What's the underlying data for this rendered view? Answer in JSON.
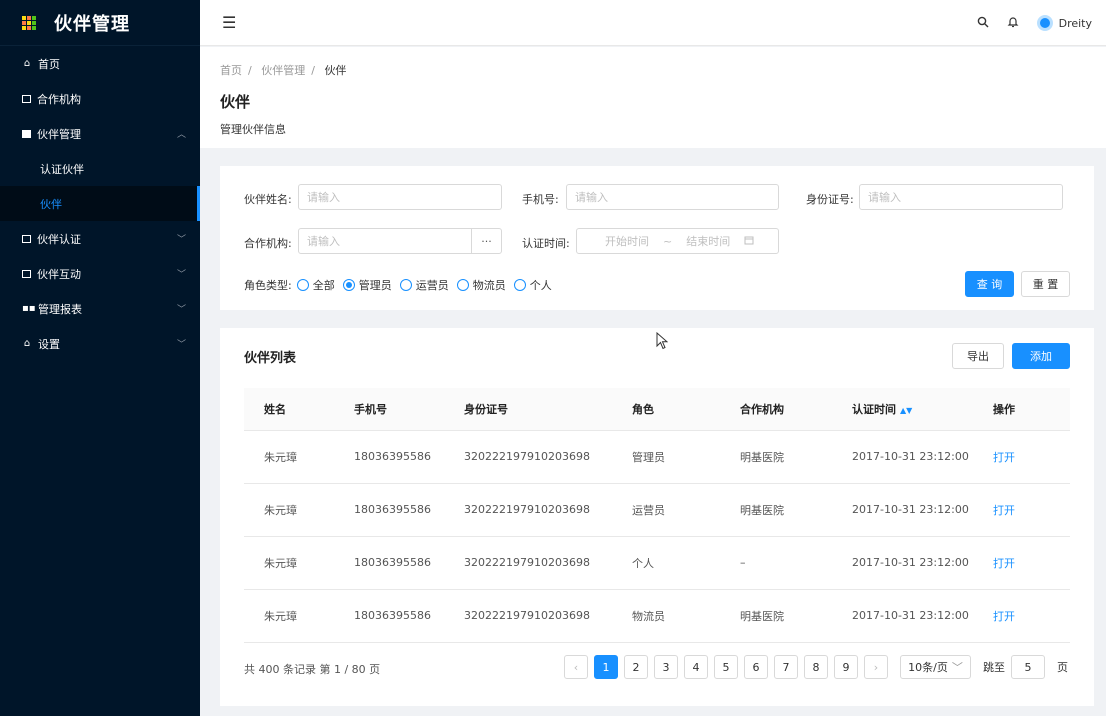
{
  "app": {
    "title": "伙伴管理"
  },
  "sidebar": {
    "items": [
      {
        "label": "首页",
        "icon": "home-icon"
      },
      {
        "label": "合作机构",
        "icon": "mail-icon"
      },
      {
        "label": "伙伴管理",
        "icon": "calendar-icon",
        "expanded": true
      },
      {
        "label": "认证伙伴",
        "sub": true
      },
      {
        "label": "伙伴",
        "sub": true,
        "active": true
      },
      {
        "label": "伙伴认证",
        "icon": "square-icon"
      },
      {
        "label": "伙伴互动",
        "icon": "monitor-icon"
      },
      {
        "label": "管理报表",
        "icon": "grid-icon"
      },
      {
        "label": "设置",
        "icon": "home-icon"
      }
    ]
  },
  "topbar": {
    "user": "Dreity"
  },
  "breadcrumb": [
    "首页",
    "伙伴管理",
    "伙伴"
  ],
  "page": {
    "title": "伙伴",
    "desc": "管理伙伴信息"
  },
  "filter": {
    "name_label": "伙伴姓名:",
    "name_placeholder": "请输入",
    "phone_label": "手机号:",
    "phone_placeholder": "请输入",
    "id_label": "身份证号:",
    "id_placeholder": "请输入",
    "org_label": "合作机构:",
    "org_placeholder": "请输入",
    "org_more": "···",
    "time_label": "认证时间:",
    "start_placeholder": "开始时间",
    "range_sep": "~",
    "end_placeholder": "结束时间",
    "role_label": "角色类型:",
    "roles": [
      "全部",
      "管理员",
      "运营员",
      "物流员",
      "个人"
    ],
    "selected_role": "管理员",
    "search_btn": "查 询",
    "reset_btn": "重 置"
  },
  "list": {
    "title": "伙伴列表",
    "export_btn": "导出",
    "add_btn": "添加",
    "columns": [
      "姓名",
      "手机号",
      "身份证号",
      "角色",
      "合作机构",
      "认证时间",
      "操作"
    ],
    "rows": [
      {
        "name": "朱元璋",
        "phone": "18036395586",
        "idno": "320222197910203698",
        "role": "管理员",
        "org": "明基医院",
        "time": "2017-10-31  23:12:00",
        "op": "打开"
      },
      {
        "name": "朱元璋",
        "phone": "18036395586",
        "idno": "320222197910203698",
        "role": "运营员",
        "org": "明基医院",
        "time": "2017-10-31  23:12:00",
        "op": "打开"
      },
      {
        "name": "朱元璋",
        "phone": "18036395586",
        "idno": "320222197910203698",
        "role": "个人",
        "org": "–",
        "time": "2017-10-31  23:12:00",
        "op": "打开"
      },
      {
        "name": "朱元璋",
        "phone": "18036395586",
        "idno": "320222197910203698",
        "role": "物流员",
        "org": "明基医院",
        "time": "2017-10-31  23:12:00",
        "op": "打开"
      }
    ]
  },
  "pagination": {
    "summary": "共 400 条记录 第 1 / 80 页",
    "pages": [
      "1",
      "2",
      "3",
      "4",
      "5",
      "6",
      "7",
      "8",
      "9"
    ],
    "current": "1",
    "prev": "‹",
    "next": "›",
    "page_size": "10条/页",
    "jump_label": "跳至",
    "jump_value": "5",
    "page_unit": "页"
  },
  "colors": {
    "primary": "#1890ff",
    "sidebar_bg": "#001529"
  }
}
